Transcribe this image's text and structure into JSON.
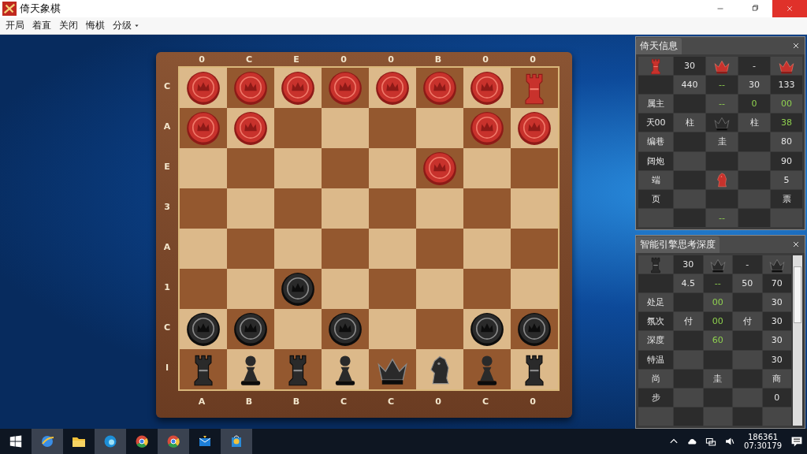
{
  "window": {
    "title": "倚天象棋"
  },
  "menu": [
    {
      "label": "开局"
    },
    {
      "label": "着直"
    },
    {
      "label": "关闭"
    },
    {
      "label": "悔棋"
    },
    {
      "label": "分级",
      "dropdown": true
    }
  ],
  "board": {
    "top_labels": [
      "0",
      "C",
      "E",
      "0",
      "0",
      "B",
      "0",
      "0"
    ],
    "bottom_labels": [
      "A",
      "B",
      "B",
      "C",
      "C",
      "0",
      "C",
      "0"
    ],
    "rank_labels": [
      "C",
      "A",
      "E",
      "3",
      "A",
      "1",
      "C",
      "I"
    ],
    "rows": [
      [
        {
          "red": true,
          "kind": "token"
        },
        {
          "red": true,
          "kind": "token"
        },
        {
          "red": true,
          "kind": "token"
        },
        {
          "red": true,
          "kind": "token"
        },
        {
          "red": true,
          "kind": "token"
        },
        {
          "red": true,
          "kind": "token"
        },
        {
          "red": true,
          "kind": "token"
        },
        {
          "red": true,
          "kind": "rook"
        }
      ],
      [
        {
          "red": true,
          "kind": "token"
        },
        {
          "red": true,
          "kind": "token"
        },
        null,
        null,
        null,
        null,
        {
          "red": true,
          "kind": "token"
        },
        {
          "red": true,
          "kind": "token"
        }
      ],
      [
        null,
        null,
        null,
        null,
        null,
        {
          "red": true,
          "kind": "token"
        },
        null,
        null
      ],
      [
        null,
        null,
        null,
        null,
        null,
        null,
        null,
        null
      ],
      [
        null,
        null,
        null,
        null,
        null,
        null,
        null,
        null
      ],
      [
        null,
        null,
        {
          "red": false,
          "kind": "token"
        },
        null,
        null,
        null,
        null,
        null
      ],
      [
        {
          "red": false,
          "kind": "token"
        },
        {
          "red": false,
          "kind": "token"
        },
        null,
        {
          "red": false,
          "kind": "token"
        },
        null,
        null,
        {
          "red": false,
          "kind": "token"
        },
        {
          "red": false,
          "kind": "token"
        }
      ],
      [
        {
          "red": false,
          "kind": "rook"
        },
        {
          "red": false,
          "kind": "pawn"
        },
        {
          "red": false,
          "kind": "rook"
        },
        {
          "red": false,
          "kind": "pawn"
        },
        {
          "red": false,
          "kind": "king"
        },
        {
          "red": false,
          "kind": "knight"
        },
        {
          "red": false,
          "kind": "pawn"
        },
        {
          "red": false,
          "kind": "rook"
        }
      ]
    ]
  },
  "panels": [
    {
      "title": "倚天信息",
      "scrollbar": false,
      "rows": [
        [
          {
            "piece": {
              "red": true,
              "kind": "rook"
            }
          },
          {
            "text": "30"
          },
          {
            "piece": {
              "red": true,
              "kind": "king"
            }
          },
          {
            "text": "-"
          },
          {
            "piece": {
              "red": true,
              "kind": "king"
            }
          }
        ],
        [
          {},
          {
            "text": "440"
          },
          {
            "text": "--",
            "highlight": true
          },
          {
            "text": "30"
          },
          {
            "text": "133"
          }
        ],
        [
          {
            "text": "属主"
          },
          {},
          {
            "text": "--",
            "highlight": true
          },
          {
            "text": "0",
            "highlight": true
          },
          {
            "text": "00",
            "highlight": true
          }
        ],
        [
          {
            "text": "天00"
          },
          {
            "text": "柱"
          },
          {
            "piece": {
              "red": false,
              "kind": "king"
            }
          },
          {
            "text": "柱"
          },
          {
            "text": "38",
            "highlight": true
          }
        ],
        [
          {
            "text": "编巷"
          },
          {},
          {
            "text": "圭"
          },
          {},
          {
            "text": "80"
          }
        ],
        [
          {
            "text": "阔炮"
          },
          {},
          {},
          {},
          {
            "text": "90"
          }
        ],
        [
          {
            "text": "端"
          },
          {},
          {
            "piece": {
              "red": true,
              "kind": "knight"
            }
          },
          {},
          {
            "text": "5"
          }
        ],
        [
          {
            "text": "页"
          },
          {},
          {},
          {},
          {
            "text": "票"
          }
        ],
        [
          {},
          {},
          {
            "text": "--",
            "highlight": true
          },
          {},
          {}
        ]
      ]
    },
    {
      "title": "智能引擎思考深度",
      "scrollbar": true,
      "rows": [
        [
          {
            "piece": {
              "red": false,
              "kind": "rook"
            }
          },
          {
            "text": "30"
          },
          {
            "piece": {
              "red": false,
              "kind": "king"
            }
          },
          {
            "text": "-"
          },
          {
            "piece": {
              "red": false,
              "kind": "king"
            }
          }
        ],
        [
          {},
          {
            "text": "4.5"
          },
          {
            "text": "--",
            "highlight": true
          },
          {
            "text": "50"
          },
          {
            "text": "70"
          }
        ],
        [
          {
            "text": "处足"
          },
          {},
          {
            "text": "00",
            "highlight": true
          },
          {},
          {
            "text": "30"
          }
        ],
        [
          {
            "text": "氛次"
          },
          {
            "text": "付"
          },
          {
            "text": "00",
            "highlight": true
          },
          {
            "text": "付"
          },
          {
            "text": "30"
          }
        ],
        [
          {
            "text": "深度"
          },
          {},
          {
            "text": "60",
            "highlight": true
          },
          {},
          {
            "text": "30"
          }
        ],
        [
          {
            "text": "特温"
          },
          {},
          {},
          {},
          {
            "text": "30"
          }
        ],
        [
          {
            "text": "尚"
          },
          {},
          {
            "text": "圭"
          },
          {},
          {
            "text": "商"
          }
        ],
        [
          {
            "text": "步"
          },
          {},
          {},
          {},
          {
            "text": "0"
          }
        ],
        [
          {},
          {},
          {},
          {},
          {}
        ]
      ]
    }
  ],
  "taskbar": {
    "apps": [
      {
        "kind": "browser-e"
      },
      {
        "kind": "folder"
      },
      {
        "kind": "edge"
      },
      {
        "kind": "chrome"
      },
      {
        "kind": "chrome"
      },
      {
        "kind": "mail"
      },
      {
        "kind": "store"
      }
    ],
    "time": "186361",
    "date": "07:30179"
  }
}
